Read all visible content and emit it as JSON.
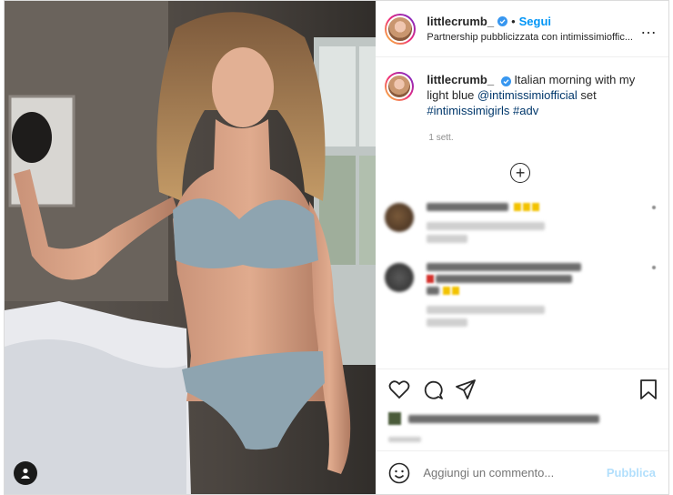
{
  "post": {
    "author": {
      "username": "littlecrumb_",
      "verified": true,
      "follow_label": "Segui",
      "separator": "•",
      "partnership_text": "Partnership pubblicizzata con intimissimioffic..."
    },
    "more_icon": "…"
  },
  "caption": {
    "username": "littlecrumb_",
    "text_before": "Italian morning with my light blue ",
    "mention": "@intimissimiofficial",
    "text_mid": " set",
    "hashtag1": "#intimissimigirls",
    "hashtag2": "#adv",
    "time": "1 sett."
  },
  "load_more_icon": "plus-circle-icon",
  "actions": {
    "icons": [
      "heart-icon",
      "comment-icon",
      "share-icon",
      "bookmark-icon"
    ]
  },
  "add_comment": {
    "placeholder": "Aggiungi un commento...",
    "publish_label": "Pubblica"
  },
  "colors": {
    "accent": "#0095f6",
    "publish_disabled": "#b2dffc",
    "link": "#00376b",
    "muted": "#8e8e8e"
  }
}
